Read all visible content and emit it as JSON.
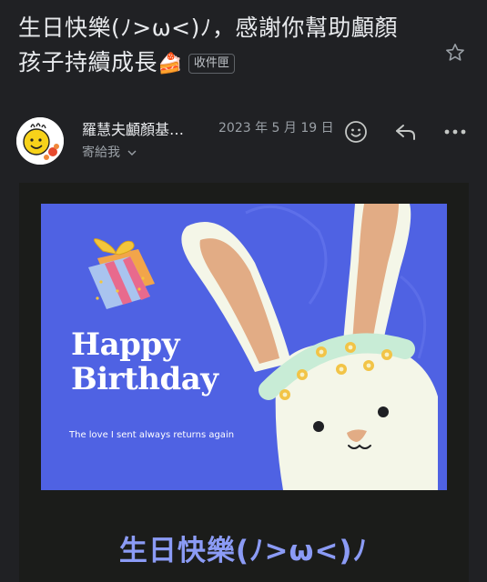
{
  "email": {
    "subject_line1": "生日快樂(ﾉ>ω<)ﾉ，感謝你幫助顱顏",
    "subject_line2": "孩子持續成長",
    "subject_emoji": "🍰",
    "label": "收件匣",
    "sender": "羅慧夫顱顏基…",
    "date": "2023 年 5 月 19 日",
    "to_me": "寄給我",
    "icons": [
      "star-icon",
      "emoji-icon",
      "reply-icon",
      "more-icon",
      "chevron-down-icon"
    ]
  },
  "card": {
    "line1": "Happy",
    "line2": "Birthday",
    "tagline": "The love I sent always returns again"
  },
  "body": {
    "title": "生日快樂(ﾉ>ω<)ﾉ"
  },
  "colors": {
    "background": "#202124",
    "card_blue": "#4f62e3",
    "body_title": "#8b9bf5"
  }
}
